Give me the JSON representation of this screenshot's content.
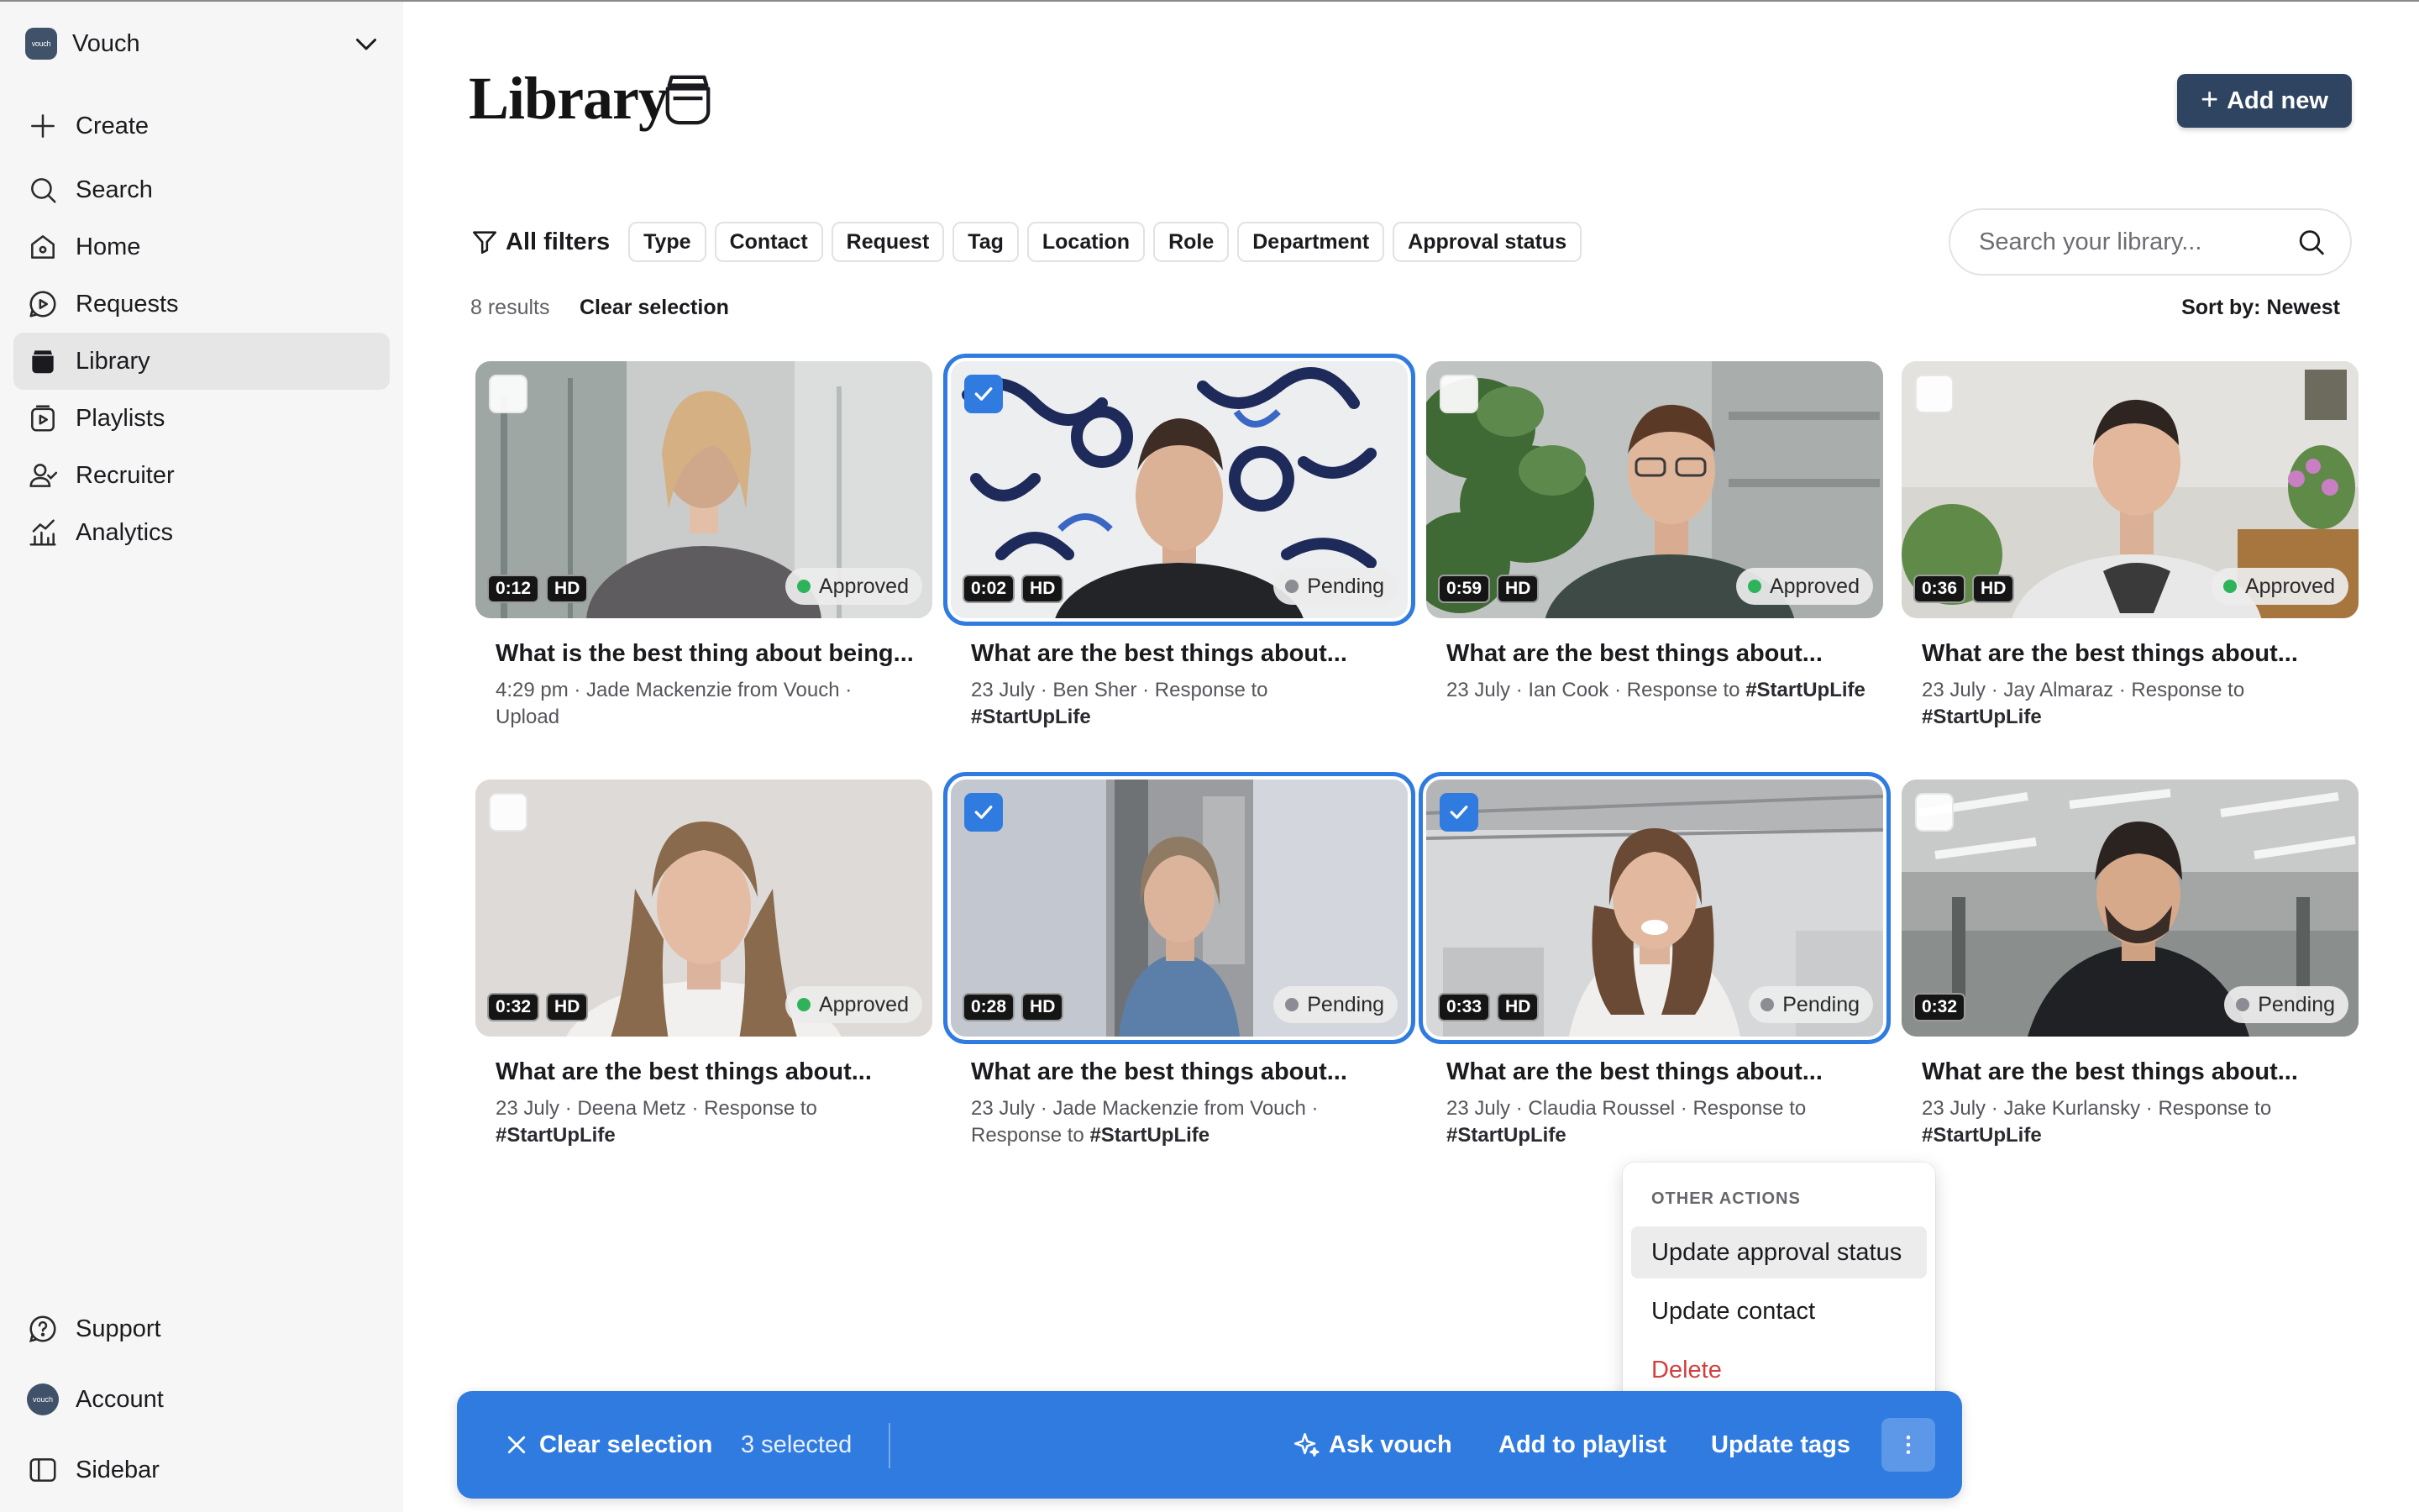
{
  "workspace": {
    "logo_text": "vouch",
    "name": "Vouch"
  },
  "sidebar": {
    "items": [
      {
        "label": "Create",
        "icon": "plus-icon"
      },
      {
        "label": "Search",
        "icon": "search-icon"
      },
      {
        "label": "Home",
        "icon": "home-icon"
      },
      {
        "label": "Requests",
        "icon": "requests-icon"
      },
      {
        "label": "Library",
        "icon": "library-icon",
        "active": true
      },
      {
        "label": "Playlists",
        "icon": "playlists-icon"
      },
      {
        "label": "Recruiter",
        "icon": "recruiter-icon"
      },
      {
        "label": "Analytics",
        "icon": "analytics-icon"
      }
    ],
    "bottom": [
      {
        "label": "Support",
        "icon": "help-icon"
      },
      {
        "label": "Account",
        "icon": "avatar-icon"
      },
      {
        "label": "Sidebar",
        "icon": "sidebar-toggle-icon"
      }
    ]
  },
  "header": {
    "title": "Library",
    "add_new_label": "Add new"
  },
  "filters": {
    "all_label": "All filters",
    "chips": [
      "Type",
      "Contact",
      "Request",
      "Tag",
      "Location",
      "Role",
      "Department",
      "Approval status"
    ]
  },
  "search": {
    "placeholder": "Search your library..."
  },
  "results": {
    "count_label": "8 results",
    "clear_selection": "Clear selection",
    "sort_label": "Sort by: Newest"
  },
  "colors": {
    "accent": "#2f7be0",
    "approved": "#2fb35a",
    "pending": "#8c8c94",
    "danger": "#d33f3f",
    "brand_dark": "#2e4460"
  },
  "cards": [
    {
      "duration": "0:12",
      "hd": "HD",
      "status": "Approved",
      "selected": false,
      "title": "What is the best thing about being...",
      "meta": "4:29 pm · Jade Mackenzie from Vouch · Upload",
      "tag": ""
    },
    {
      "duration": "0:02",
      "hd": "HD",
      "status": "Pending",
      "selected": true,
      "title": "What are the best things about...",
      "meta": "23 July · Ben Sher · Response to",
      "tag": "#StartUpLife"
    },
    {
      "duration": "0:59",
      "hd": "HD",
      "status": "Approved",
      "selected": false,
      "title": "What are the best things about...",
      "meta": "23 July · Ian Cook · Response to",
      "tag": "#StartUpLife"
    },
    {
      "duration": "0:36",
      "hd": "HD",
      "status": "Approved",
      "selected": false,
      "title": "What are the best things about...",
      "meta": "23 July · Jay Almaraz · Response to",
      "tag": "#StartUpLife"
    },
    {
      "duration": "0:32",
      "hd": "HD",
      "status": "Approved",
      "selected": false,
      "title": "What are the best things about...",
      "meta": "23 July · Deena Metz · Response to",
      "tag": "#StartUpLife"
    },
    {
      "duration": "0:28",
      "hd": "HD",
      "status": "Pending",
      "selected": true,
      "title": "What are the best things about...",
      "meta": "23 July · Jade Mackenzie from Vouch · Response to",
      "tag": "#StartUpLife"
    },
    {
      "duration": "0:33",
      "hd": "HD",
      "status": "Pending",
      "selected": true,
      "title": "What are the best things about...",
      "meta": "23 July · Claudia Roussel · Response to",
      "tag": "#StartUpLife"
    },
    {
      "duration": "0:32",
      "hd": "",
      "status": "Pending",
      "selected": false,
      "title": "What are the best things about...",
      "meta": "23 July · Jake Kurlansky · Response to",
      "tag": "#StartUpLife"
    }
  ],
  "context_menu": {
    "header": "OTHER ACTIONS",
    "items": [
      {
        "label": "Update approval status",
        "hover": true
      },
      {
        "label": "Update contact"
      },
      {
        "label": "Delete",
        "danger": true
      }
    ]
  },
  "action_bar": {
    "clear_label": "Clear selection",
    "selected_count": "3 selected",
    "ask_label": "Ask vouch",
    "playlist_label": "Add to playlist",
    "tags_label": "Update tags"
  }
}
